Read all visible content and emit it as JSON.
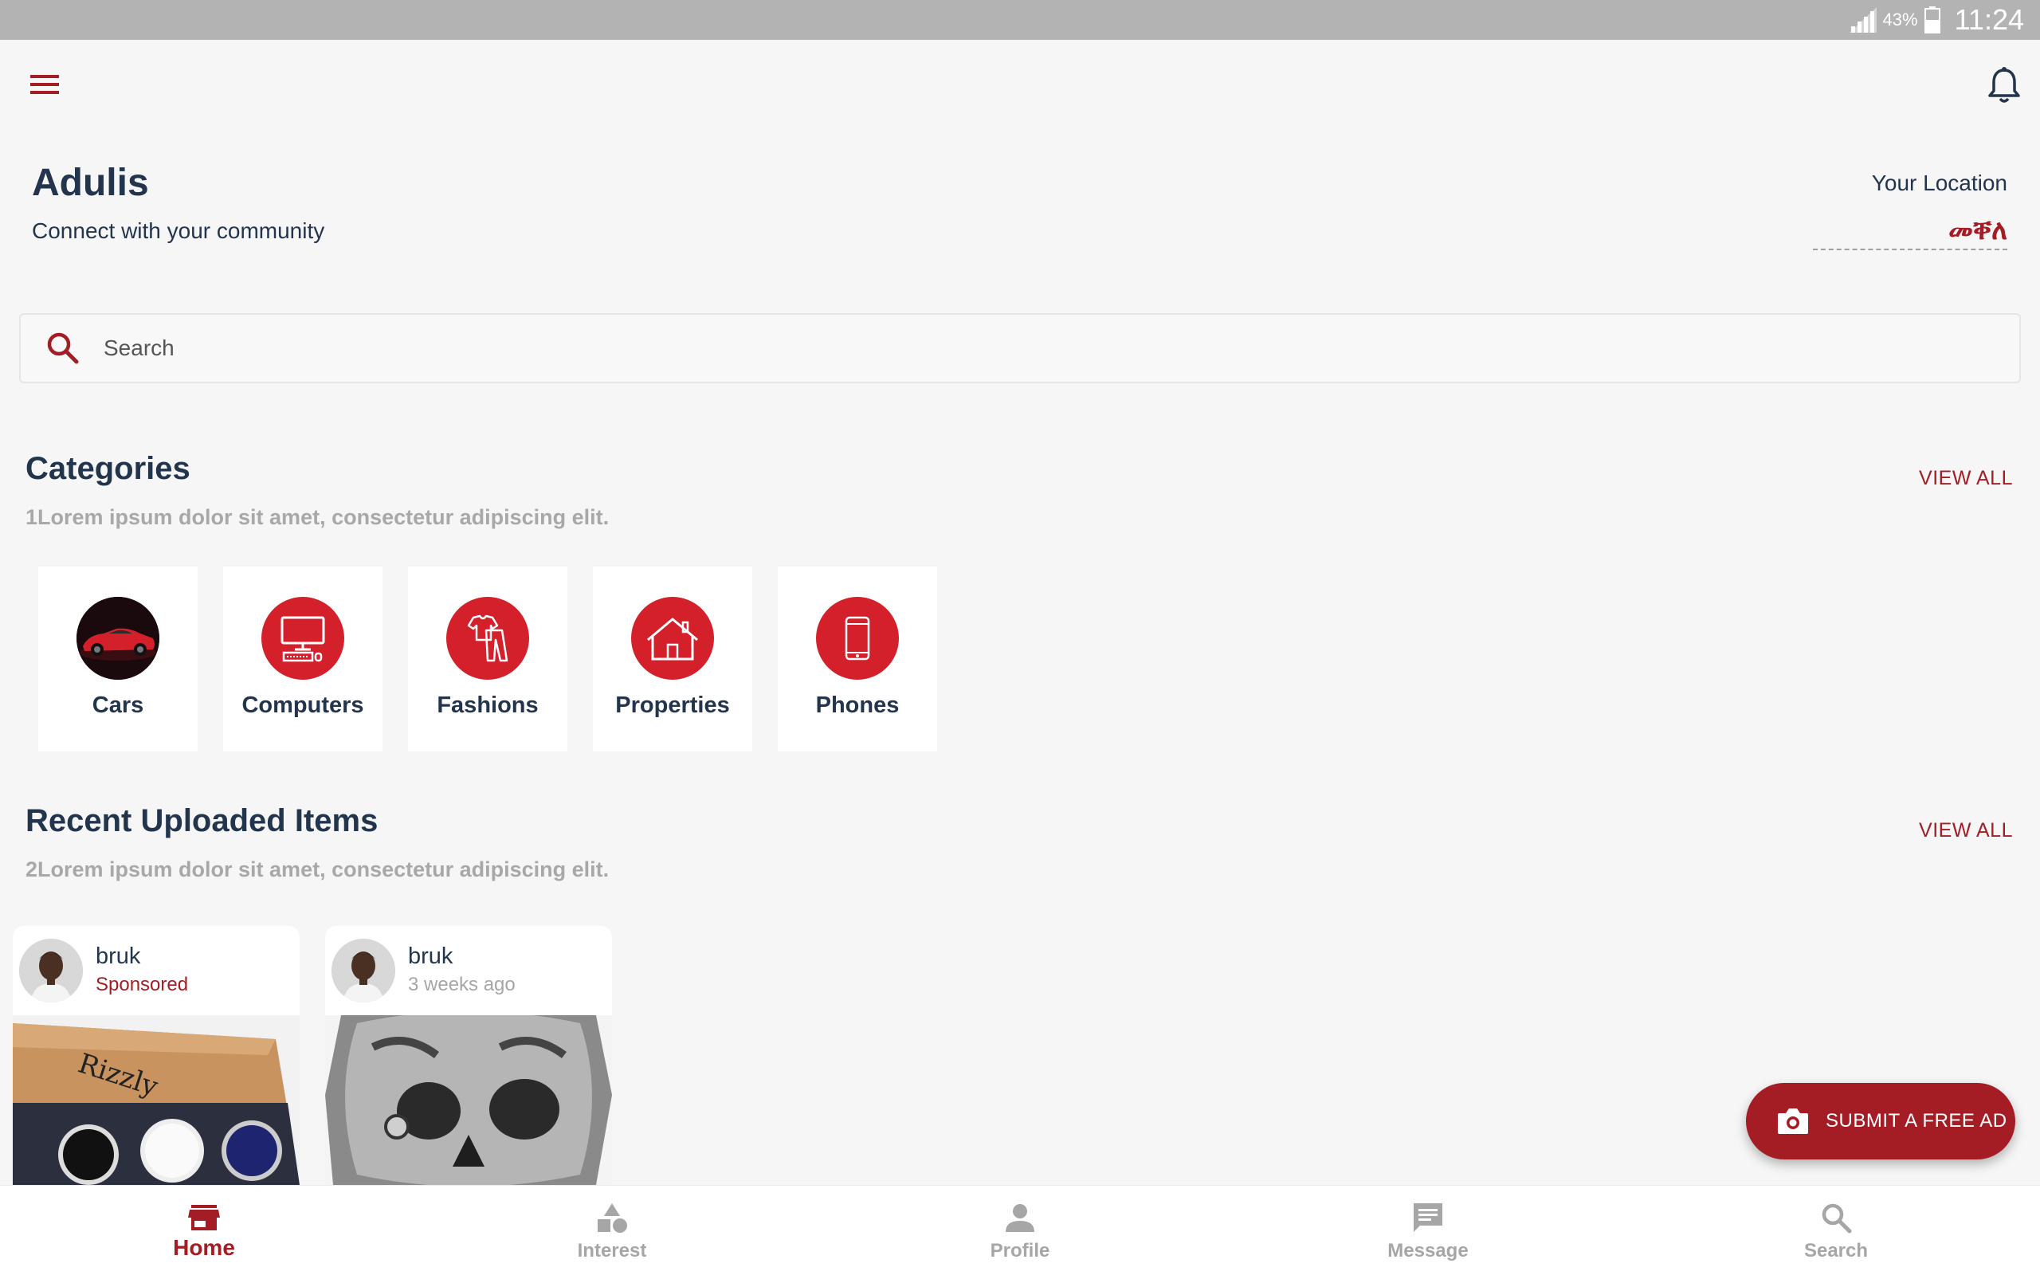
{
  "status_bar": {
    "battery_percent": "43%",
    "time": "11:24"
  },
  "header": {
    "title": "Adulis",
    "subtitle": "Connect with your community",
    "location_label": "Your Location",
    "location_value": "መቐለ"
  },
  "search": {
    "placeholder": "Search"
  },
  "categories": {
    "title": "Categories",
    "description": "1Lorem ipsum dolor sit amet, consectetur adipiscing elit.",
    "view_all": "VIEW ALL",
    "items": [
      {
        "label": "Cars",
        "icon": "car-photo-icon"
      },
      {
        "label": "Computers",
        "icon": "computer-icon"
      },
      {
        "label": "Fashions",
        "icon": "clothing-icon"
      },
      {
        "label": "Properties",
        "icon": "house-icon"
      },
      {
        "label": "Phones",
        "icon": "phone-icon"
      }
    ]
  },
  "recent": {
    "title": "Recent Uploaded Items",
    "description": "2Lorem ipsum dolor sit amet, consectetur adipiscing elit.",
    "view_all": "VIEW ALL",
    "items": [
      {
        "user": "bruk",
        "meta": "Sponsored",
        "image": "watches-box-photo"
      },
      {
        "user": "bruk",
        "meta": "3 weeks ago",
        "image": "skull-ring-photo"
      }
    ]
  },
  "fab": {
    "label": "SUBMIT A FREE AD",
    "icon": "camera-icon"
  },
  "bottom_nav": [
    {
      "label": "Home",
      "icon": "store-icon",
      "active": true
    },
    {
      "label": "Interest",
      "icon": "shapes-icon",
      "active": false
    },
    {
      "label": "Profile",
      "icon": "person-icon",
      "active": false
    },
    {
      "label": "Message",
      "icon": "chat-icon",
      "active": false
    },
    {
      "label": "Search",
      "icon": "search-icon",
      "active": false
    }
  ],
  "colors": {
    "accent": "#a51d24",
    "category_circle": "#d4202a",
    "heading": "#23354d",
    "muted": "#a8a8a8",
    "background": "#f6f6f6",
    "status_bar": "#b3b3b3"
  }
}
